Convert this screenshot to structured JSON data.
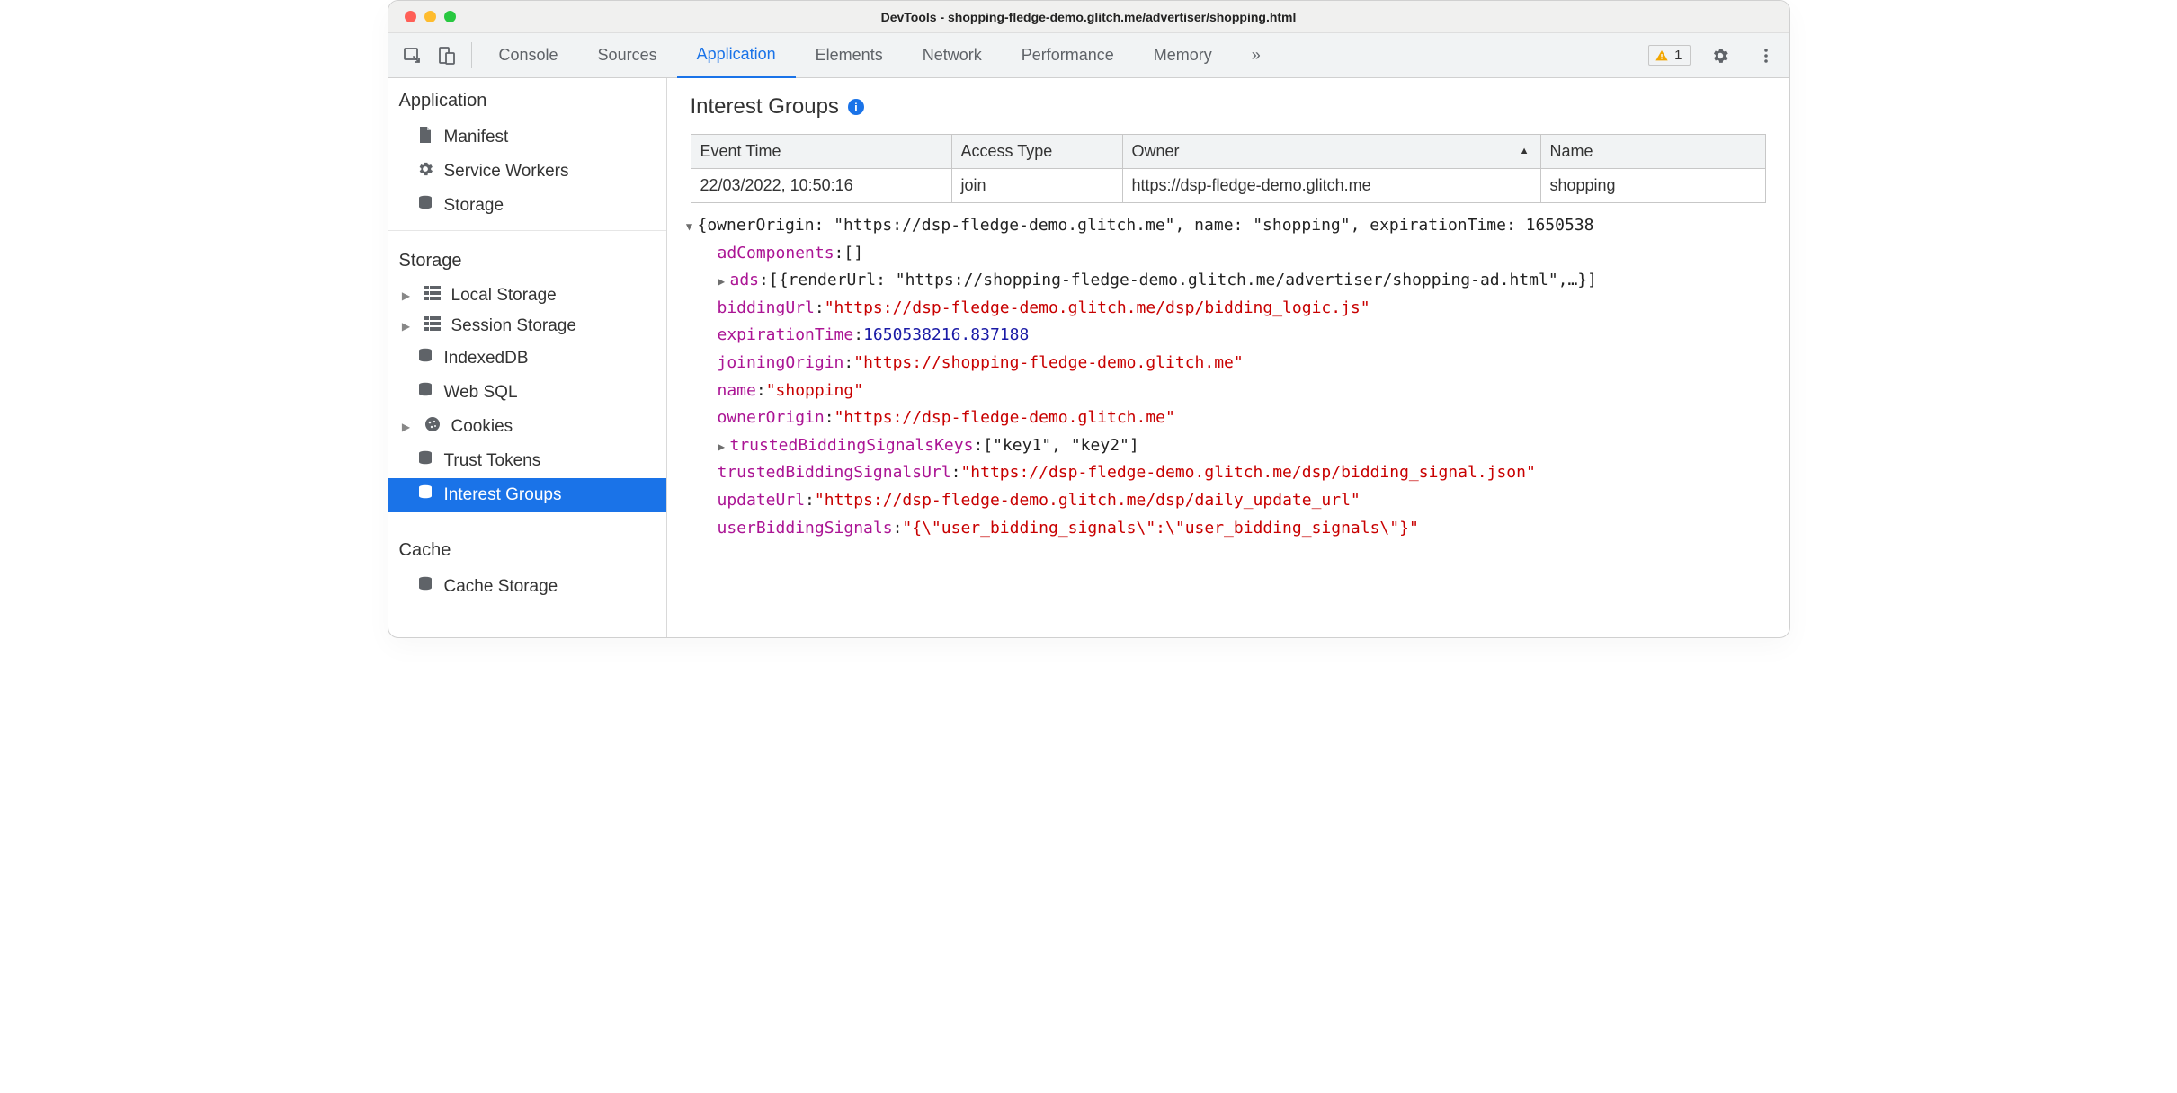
{
  "window": {
    "title": "DevTools - shopping-fledge-demo.glitch.me/advertiser/shopping.html"
  },
  "toolbar": {
    "tabs": [
      "Console",
      "Sources",
      "Application",
      "Elements",
      "Network",
      "Performance",
      "Memory"
    ],
    "activeTab": "Application",
    "moreGlyph": "»",
    "warnCount": "1"
  },
  "sidebar": {
    "sections": [
      {
        "title": "Application",
        "items": [
          {
            "label": "Manifest",
            "icon": "file-icon",
            "caret": ""
          },
          {
            "label": "Service Workers",
            "icon": "gear-icon",
            "caret": ""
          },
          {
            "label": "Storage",
            "icon": "database-icon",
            "caret": ""
          }
        ]
      },
      {
        "title": "Storage",
        "items": [
          {
            "label": "Local Storage",
            "icon": "grid-icon",
            "caret": "▶"
          },
          {
            "label": "Session Storage",
            "icon": "grid-icon",
            "caret": "▶"
          },
          {
            "label": "IndexedDB",
            "icon": "database-icon",
            "caret": ""
          },
          {
            "label": "Web SQL",
            "icon": "database-icon",
            "caret": ""
          },
          {
            "label": "Cookies",
            "icon": "cookie-icon",
            "caret": "▶"
          },
          {
            "label": "Trust Tokens",
            "icon": "database-icon",
            "caret": ""
          },
          {
            "label": "Interest Groups",
            "icon": "database-icon",
            "caret": "",
            "selected": true
          }
        ]
      },
      {
        "title": "Cache",
        "items": [
          {
            "label": "Cache Storage",
            "icon": "database-icon",
            "caret": ""
          }
        ]
      }
    ]
  },
  "main": {
    "title": "Interest Groups",
    "table": {
      "columns": [
        "Event Time",
        "Access Type",
        "Owner",
        "Name"
      ],
      "sortCol": "Owner",
      "rows": [
        {
          "time": "22/03/2022, 10:50:16",
          "access": "join",
          "owner": "https://dsp-fledge-demo.glitch.me",
          "name": "shopping"
        }
      ]
    },
    "details": {
      "topSummary": "{ownerOrigin: \"https://dsp-fledge-demo.glitch.me\", name: \"shopping\", expirationTime: 1650538",
      "adComponents": "[]",
      "adsSummary": "[{renderUrl: \"https://shopping-fledge-demo.glitch.me/advertiser/shopping-ad.html\",…}]",
      "biddingUrl": "\"https://dsp-fledge-demo.glitch.me/dsp/bidding_logic.js\"",
      "expirationTime": "1650538216.837188",
      "joiningOrigin": "\"https://shopping-fledge-demo.glitch.me\"",
      "name": "\"shopping\"",
      "ownerOrigin": "\"https://dsp-fledge-demo.glitch.me\"",
      "trustedBiddingSignalsKeys": "[\"key1\", \"key2\"]",
      "trustedBiddingSignalsUrl": "\"https://dsp-fledge-demo.glitch.me/dsp/bidding_signal.json\"",
      "updateUrl": "\"https://dsp-fledge-demo.glitch.me/dsp/daily_update_url\"",
      "userBiddingSignals": "\"{\\\"user_bidding_signals\\\":\\\"user_bidding_signals\\\"}\""
    }
  },
  "icons": {
    "file-icon": "📄",
    "gear-icon": "⚙",
    "database-icon": "🗄",
    "grid-icon": "▦",
    "cookie-icon": "🍪"
  }
}
